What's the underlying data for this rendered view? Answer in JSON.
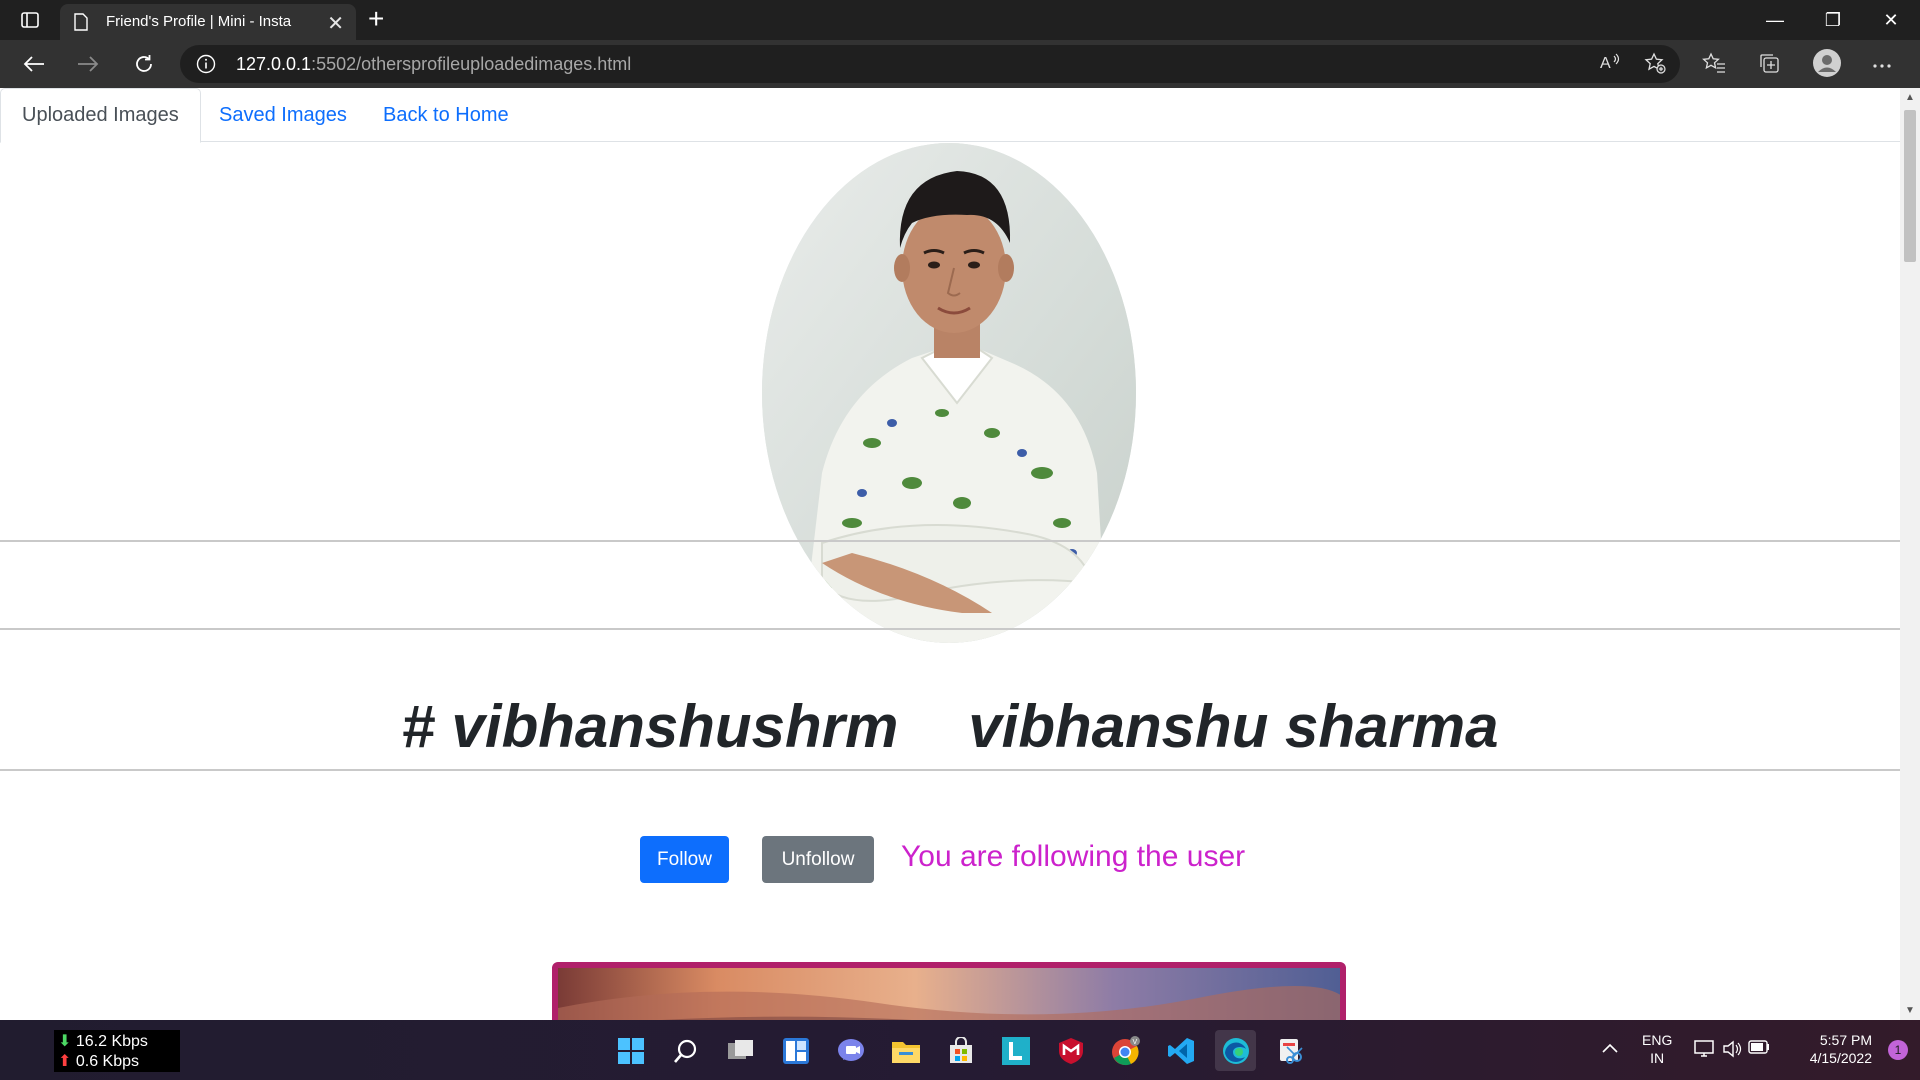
{
  "browser": {
    "tab_title": "Friend's Profile | Mini - Insta",
    "new_tab_symbol": "+",
    "close_symbol": "✕",
    "url_host": "127.0.0.1",
    "url_rest": ":5502/othersprofileuploadedimages.html",
    "window_controls": [
      "—",
      "❐",
      "✕"
    ]
  },
  "nav": {
    "tabs": [
      {
        "label": "Uploaded Images",
        "active": true
      },
      {
        "label": "Saved Images",
        "active": false
      },
      {
        "label": "Back to Home",
        "active": false
      }
    ]
  },
  "profile": {
    "username": "# vibhanshushrm",
    "full_name": "vibhanshu sharma",
    "follow_label": "Follow",
    "unfollow_label": "Unfollow",
    "status": "You are following the user"
  },
  "colors": {
    "follow_button": "#0d6efd",
    "unfollow_button": "#6c757d",
    "status_text": "#cc22cc",
    "post_border": "#b0206a"
  },
  "taskbar": {
    "net_down": "16.2 Kbps",
    "net_up": "0.6 Kbps",
    "lang_line1": "ENG",
    "lang_line2": "IN",
    "time": "5:57 PM",
    "date": "4/15/2022",
    "notification_count": "1",
    "icons": [
      "windows-start-icon",
      "search-icon",
      "task-view-icon",
      "widgets-icon",
      "teams-chat-icon",
      "file-explorer-icon",
      "microsoft-store-icon",
      "l-app-icon",
      "mcafee-icon",
      "chrome-icon",
      "vscode-icon",
      "edge-icon",
      "snipping-tool-icon"
    ]
  }
}
